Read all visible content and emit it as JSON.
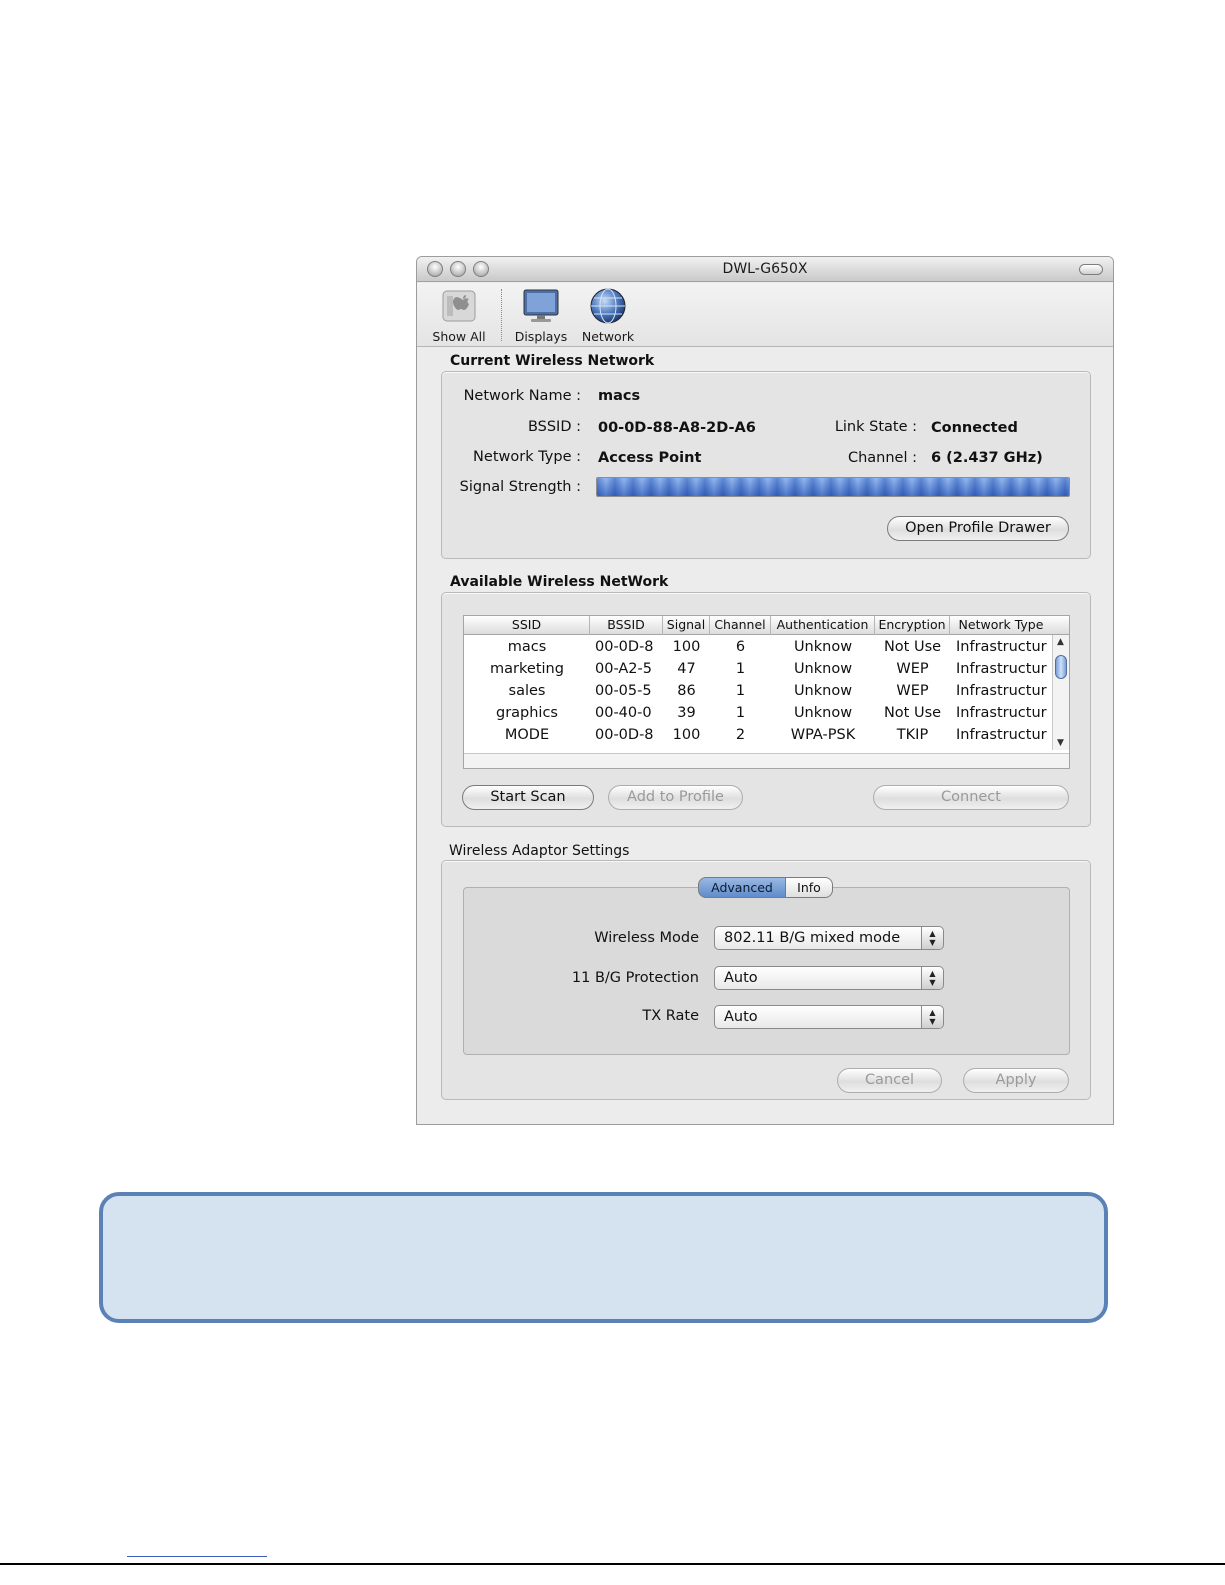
{
  "window": {
    "title": "DWL-G650X"
  },
  "toolbar": {
    "items": [
      {
        "label": "Show All",
        "icon": "apple-icon"
      },
      {
        "label": "Displays",
        "icon": "display-icon"
      },
      {
        "label": "Network",
        "icon": "globe-icon"
      }
    ]
  },
  "current": {
    "group_label": "Current Wireless Network",
    "network_name_label": "Network Name :",
    "network_name": "macs",
    "bssid_label": "BSSID :",
    "bssid": "00-0D-88-A8-2D-A6",
    "link_state_label": "Link State :",
    "link_state": "Connected",
    "network_type_label": "Network Type :",
    "network_type": "Access Point",
    "channel_label": "Channel :",
    "channel": "6 (2.437 GHz)",
    "signal_label": "Signal Strength :",
    "signal_fraction": 1.0,
    "open_profile_button": "Open Profile Drawer"
  },
  "available": {
    "group_label": "Available Wireless NetWork",
    "columns": [
      "SSID",
      "BSSID",
      "Signal",
      "Channel",
      "Authentication",
      "Encryption",
      "Network Type"
    ],
    "rows": [
      [
        "macs",
        "00-0D-8",
        "100",
        "6",
        "Unknow",
        "Not Use",
        "Infrastructur"
      ],
      [
        "marketing",
        "00-A2-5",
        "47",
        "1",
        "Unknow",
        "WEP",
        "Infrastructur"
      ],
      [
        "sales",
        "00-05-5",
        "86",
        "1",
        "Unknow",
        "WEP",
        "Infrastructur"
      ],
      [
        "graphics",
        "00-40-0",
        "39",
        "1",
        "Unknow",
        "Not Use",
        "Infrastructur"
      ],
      [
        "MODE",
        "00-0D-8",
        "100",
        "2",
        "WPA-PSK",
        "TKIP",
        "Infrastructur"
      ]
    ],
    "start_scan": "Start Scan",
    "add_to_profile": "Add to Profile",
    "connect": "Connect"
  },
  "adaptor": {
    "group_label": "Wireless Adaptor Settings",
    "tabs": [
      "Advanced",
      "Info"
    ],
    "wireless_mode_label": "Wireless Mode",
    "wireless_mode": "802.11 B/G mixed mode",
    "protection_label": "11 B/G Protection",
    "protection": "Auto",
    "tx_rate_label": "TX Rate",
    "tx_rate": "Auto",
    "cancel": "Cancel",
    "apply": "Apply"
  },
  "colors": {
    "note_fill": "#d5e2f0",
    "note_border": "#5b82b6",
    "selection_blue": "#5f8ccb"
  }
}
